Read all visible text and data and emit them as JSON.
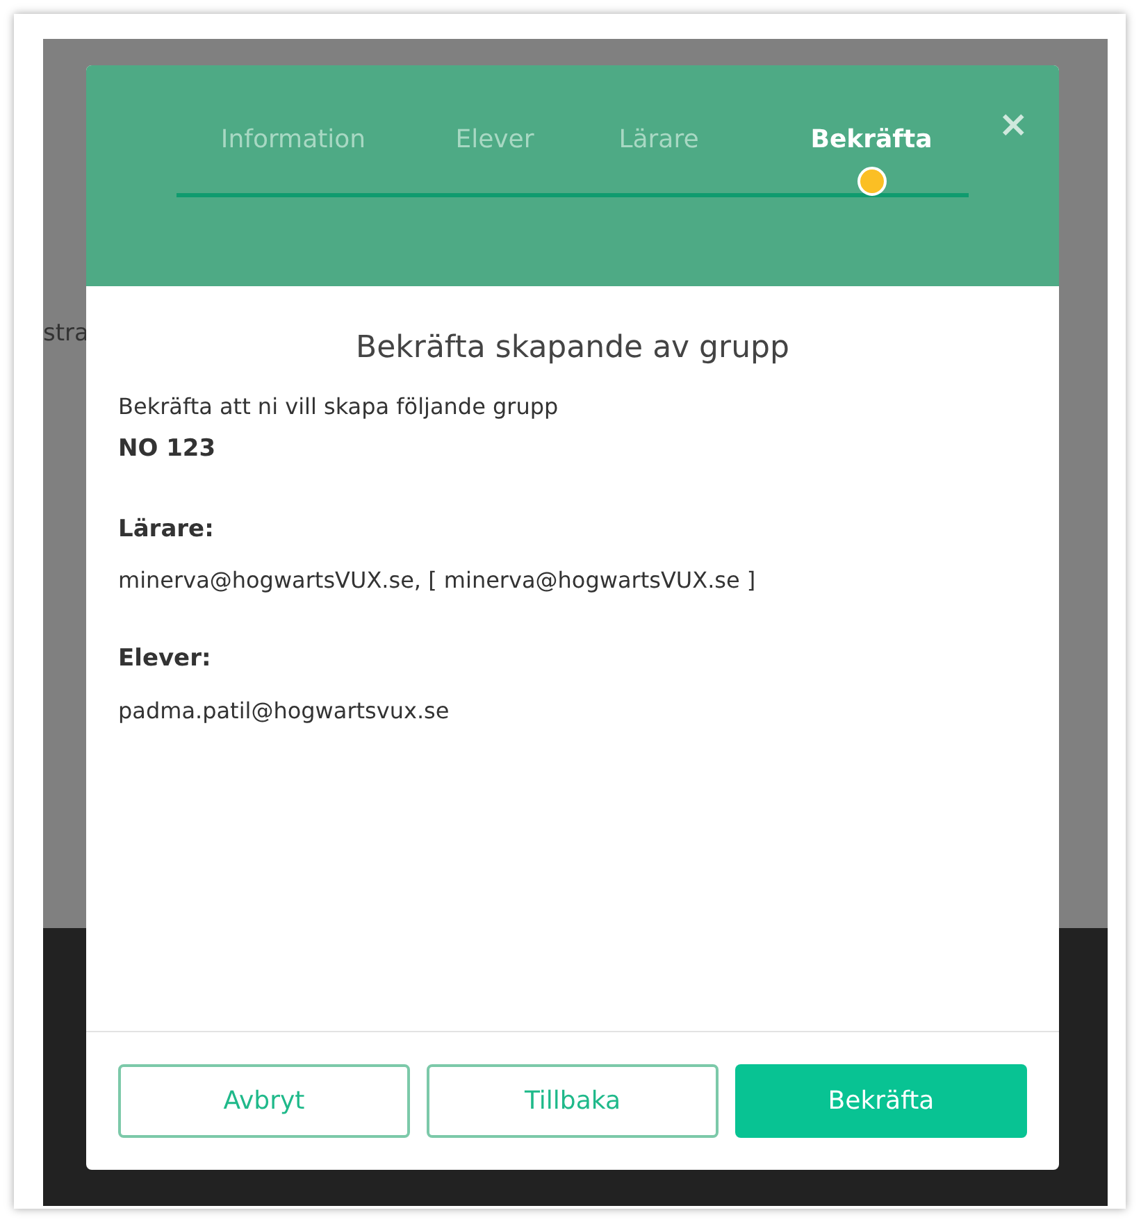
{
  "background": {
    "partial_text": "stra"
  },
  "dialog": {
    "steps": [
      {
        "label": "Information",
        "selected": false
      },
      {
        "label": "Elever",
        "selected": false
      },
      {
        "label": "Lärare",
        "selected": false
      },
      {
        "label": "Bekräfta",
        "selected": true
      }
    ],
    "close": "×",
    "title": "Bekräfta skapande av grupp",
    "intro": "Bekräfta att ni vill skapa följande grupp",
    "group_name": "NO 123",
    "sections": [
      {
        "heading": "Lärare:",
        "value": "minerva@hogwartsVUX.se, [ minerva@hogwartsVUX.se ]"
      },
      {
        "heading": "Elever:",
        "value": "padma.patil@hogwartsvux.se"
      }
    ],
    "buttons": [
      {
        "label": "Avbryt",
        "kind": "outline"
      },
      {
        "label": "Tillbaka",
        "kind": "outline"
      },
      {
        "label": "Bekräfta",
        "kind": "primary"
      }
    ]
  }
}
